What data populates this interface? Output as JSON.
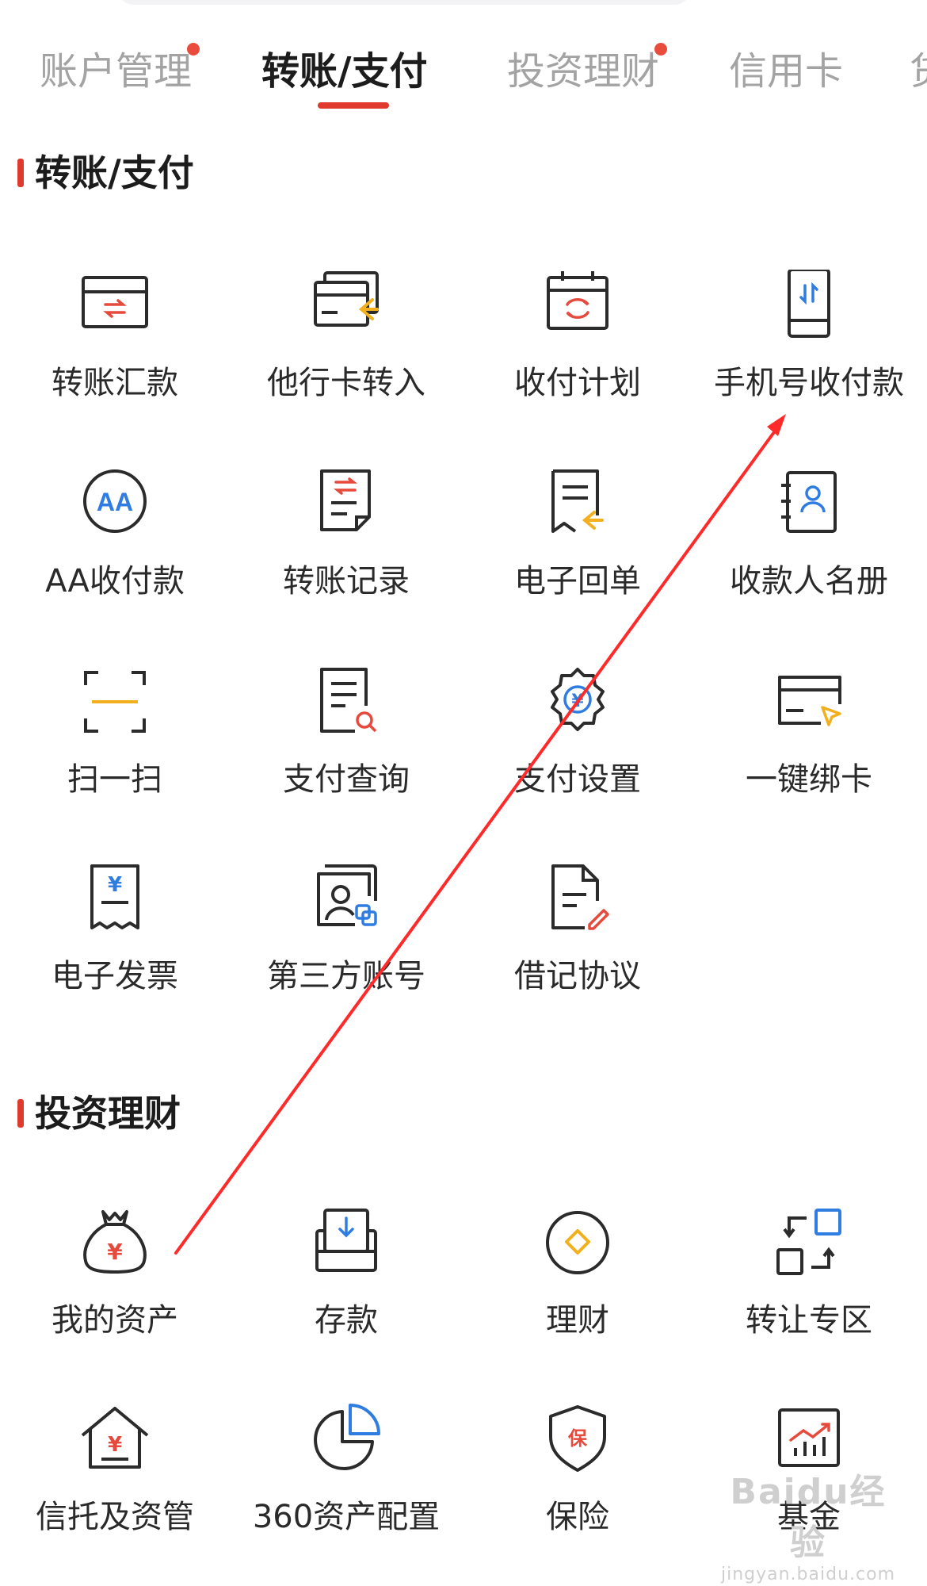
{
  "tabs": [
    {
      "label": "账户管理",
      "badge": true
    },
    {
      "label": "转账/支付",
      "active": true
    },
    {
      "label": "投资理财",
      "badge": true
    },
    {
      "label": "信用卡"
    },
    {
      "label": "贷"
    }
  ],
  "sections": {
    "transfer": {
      "title": "转账/支付",
      "items": [
        {
          "label": "转账汇款",
          "icon": "transfer-card-icon"
        },
        {
          "label": "他行卡转入",
          "icon": "card-transfer-in-icon"
        },
        {
          "label": "收付计划",
          "icon": "payment-plan-calendar-icon"
        },
        {
          "label": "手机号收付款",
          "icon": "phone-transfer-icon"
        },
        {
          "label": "AA收付款",
          "icon": "aa-payment-icon"
        },
        {
          "label": "转账记录",
          "icon": "transfer-record-icon"
        },
        {
          "label": "电子回单",
          "icon": "e-receipt-icon"
        },
        {
          "label": "收款人名册",
          "icon": "payee-contacts-icon"
        },
        {
          "label": "扫一扫",
          "icon": "scan-icon"
        },
        {
          "label": "支付查询",
          "icon": "payment-search-icon"
        },
        {
          "label": "支付设置",
          "icon": "payment-settings-gear-icon"
        },
        {
          "label": "一键绑卡",
          "icon": "bind-card-icon"
        },
        {
          "label": "电子发票",
          "icon": "e-invoice-icon"
        },
        {
          "label": "第三方账号",
          "icon": "third-party-account-icon"
        },
        {
          "label": "借记协议",
          "icon": "debit-agreement-icon"
        }
      ]
    },
    "invest": {
      "title": "投资理财",
      "items": [
        {
          "label": "我的资产",
          "icon": "money-bag-icon"
        },
        {
          "label": "存款",
          "icon": "deposit-icon"
        },
        {
          "label": "理财",
          "icon": "wealth-diamond-icon"
        },
        {
          "label": "转让专区",
          "icon": "transfer-zone-icon"
        },
        {
          "label": "信托及资管",
          "icon": "trust-house-icon"
        },
        {
          "label": "360资产配置",
          "icon": "asset-pie-chart-icon"
        },
        {
          "label": "保险",
          "icon": "insurance-shield-icon"
        },
        {
          "label": "基金",
          "icon": "fund-chart-icon"
        }
      ]
    }
  },
  "annotations": {
    "arrow_color": "#ff2a2a"
  },
  "colors": {
    "accent": "#e0392d",
    "icon_stroke": "#2b2b2b",
    "icon_red": "#e54a3c",
    "icon_blue": "#2f7de1",
    "icon_yellow": "#f2b01e"
  },
  "watermark": {
    "main": "Baidu经验",
    "sub": "jingyan.baidu.com"
  }
}
